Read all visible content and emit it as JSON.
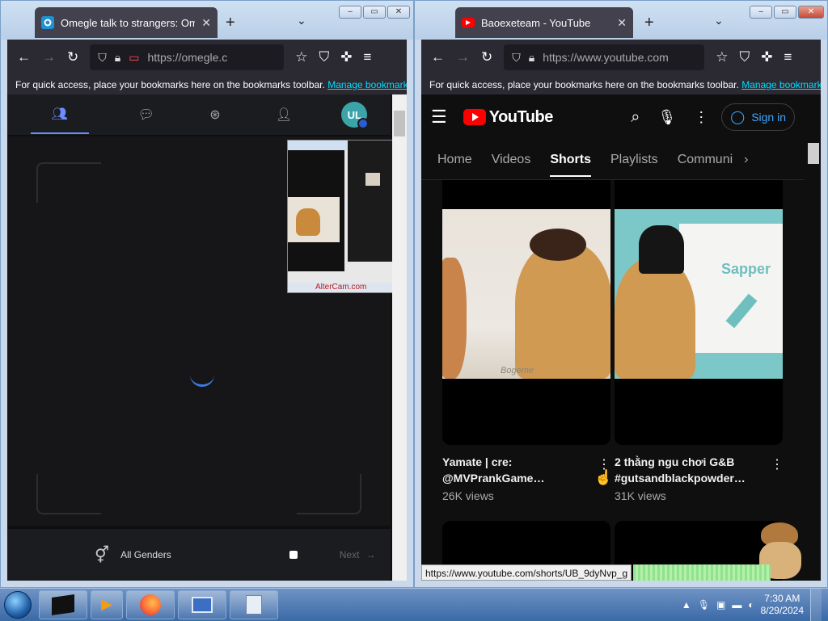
{
  "left_window": {
    "tab_title": "Omegle talk to strangers: Omegle",
    "url": "https://omegle.c",
    "bookmarks_text": "For quick access, place your bookmarks here on the bookmarks toolbar.",
    "bookmarks_link": "Manage bookmarks",
    "avatar_initials": "UL",
    "gender_filter": "All Genders",
    "next_label": "Next",
    "thumb_watermark": "AlterCam.com"
  },
  "right_window": {
    "tab_title": "Baoexeteam - YouTube",
    "url": "https://www.youtube.com",
    "bookmarks_text": "For quick access, place your bookmarks here on the bookmarks toolbar.",
    "bookmarks_link": "Manage bookmarks",
    "logo_text": "YouTube",
    "signin_label": "Sign in",
    "tabs": [
      "Home",
      "Videos",
      "Shorts",
      "Playlists",
      "Communi"
    ],
    "active_tab": "Shorts",
    "shorts": [
      {
        "title_line1": "Yamate | cre:",
        "title_line2": "@MVPrankGame…",
        "views": "26K views",
        "overlay": "Bogeme"
      },
      {
        "title_line1": "2 thằng ngu chơi G&B",
        "title_line2": "#gutsandblackpowder…",
        "views": "31K views",
        "overlay": "Sapper"
      }
    ],
    "status_url": "https://www.youtube.com/shorts/UB_9dyNvp_g"
  },
  "taskbar": {
    "time": "7:30 AM",
    "date": "8/29/2024"
  },
  "colors": {
    "firefox_dark": "#1c1b22",
    "youtube_red": "#ff0000",
    "link_blue": "#3ea6ff",
    "omegle_accent": "#6d8cff"
  }
}
